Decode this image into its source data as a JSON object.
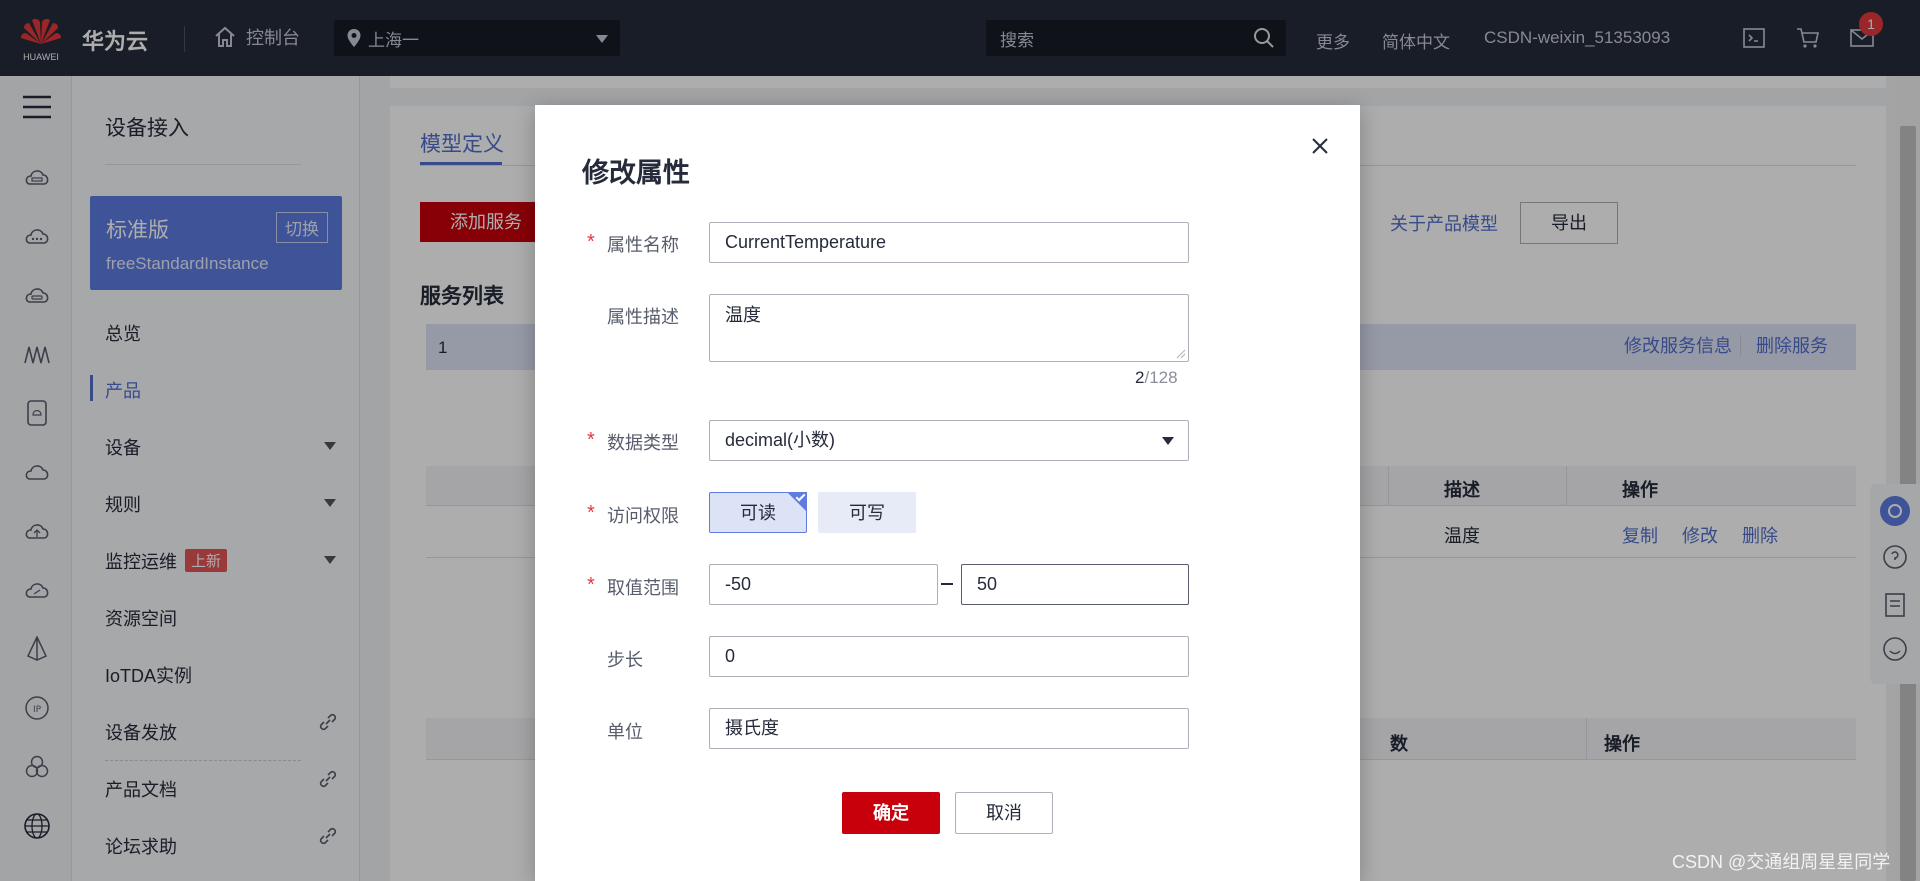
{
  "topbar": {
    "logo_text": "华为云",
    "logo_caption": "HUAWEI",
    "console": "控制台",
    "region": "上海一",
    "search_placeholder": "搜索",
    "more": "更多",
    "language": "简体中文",
    "username": "CSDN-weixin_51353093",
    "mail_badge": "1"
  },
  "menu": {
    "title": "设备接入",
    "edition": {
      "name": "标准版",
      "switch": "切换",
      "instance": "freeStandardInstance"
    },
    "items": [
      {
        "label": "总览"
      },
      {
        "label": "产品",
        "active": true
      },
      {
        "label": "设备",
        "expandable": true
      },
      {
        "label": "规则",
        "expandable": true
      },
      {
        "label": "监控运维",
        "expandable": true,
        "badge": "上新"
      },
      {
        "label": "资源空间"
      },
      {
        "label": "IoTDA实例"
      },
      {
        "label": "设备发放",
        "external": true
      },
      {
        "label": "产品文档",
        "external": true
      },
      {
        "label": "论坛求助",
        "external": true
      }
    ]
  },
  "page": {
    "tab": "模型定义",
    "add_service": "添加服务",
    "about_model": "关于产品模型",
    "export": "导出",
    "service_list_title": "服务列表",
    "service_row_index": "1",
    "edit_service": "修改服务信息",
    "delete_service": "删除服务",
    "property_table": {
      "headers": [
        "描述",
        "操作"
      ],
      "row": {
        "description": "温度",
        "actions": [
          "复制",
          "修改",
          "删除"
        ]
      }
    },
    "command_table": {
      "headers": [
        "数",
        "操作"
      ]
    }
  },
  "dialog": {
    "title": "修改属性",
    "fields": {
      "name": {
        "label": "属性名称",
        "value": "CurrentTemperature",
        "required": true
      },
      "desc": {
        "label": "属性描述",
        "value": "温度",
        "count": "2",
        "max": "/128"
      },
      "type": {
        "label": "数据类型",
        "value": "decimal(小数)",
        "required": true
      },
      "access": {
        "label": "访问权限",
        "required": true,
        "options": [
          "可读",
          "可写"
        ],
        "selected": "可读"
      },
      "range": {
        "label": "取值范围",
        "required": true,
        "min": "-50",
        "max": "50"
      },
      "step": {
        "label": "步长",
        "value": "0"
      },
      "unit": {
        "label": "单位",
        "value": "摄氏度"
      }
    },
    "ok": "确定",
    "cancel": "取消"
  },
  "watermark": "CSDN @交通组周星星同学",
  "colors": {
    "brand_red": "#c7000b",
    "accent_blue": "#526ecc",
    "topbar_bg": "#252b3a"
  }
}
